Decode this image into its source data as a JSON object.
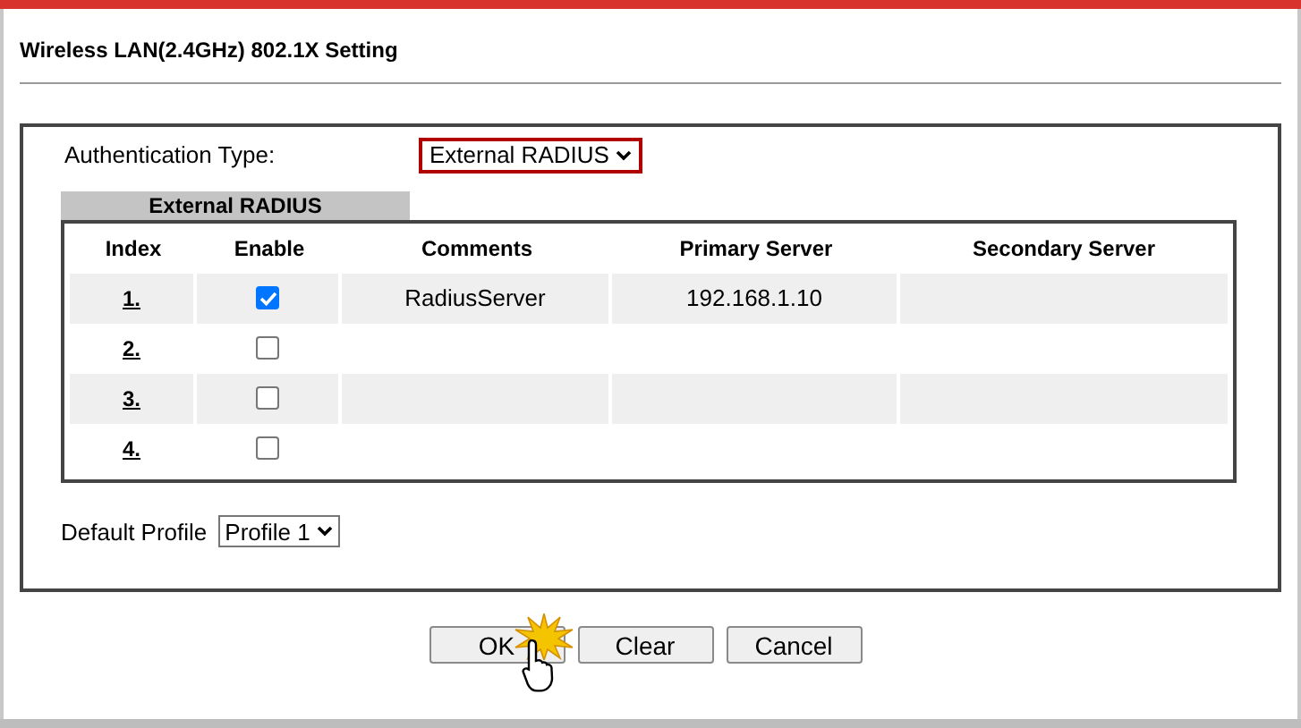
{
  "title": "Wireless LAN(2.4GHz) 802.1X Setting",
  "authentication": {
    "label": "Authentication Type:",
    "value": "External RADIUS",
    "highlighted": true
  },
  "section_tab": "External RADIUS",
  "table": {
    "columns": [
      "Index",
      "Enable",
      "Comments",
      "Primary Server",
      "Secondary Server"
    ],
    "rows": [
      {
        "index": "1.",
        "enabled": true,
        "comments": "RadiusServer",
        "primary_server": "192.168.1.10"
      },
      {
        "index": "2.",
        "enabled": false
      },
      {
        "index": "3.",
        "enabled": false
      },
      {
        "index": "4.",
        "enabled": false
      }
    ]
  },
  "default_profile": {
    "label": "Default Profile",
    "value": "Profile 1"
  },
  "buttons": [
    "OK",
    "Clear",
    "Cancel"
  ]
}
